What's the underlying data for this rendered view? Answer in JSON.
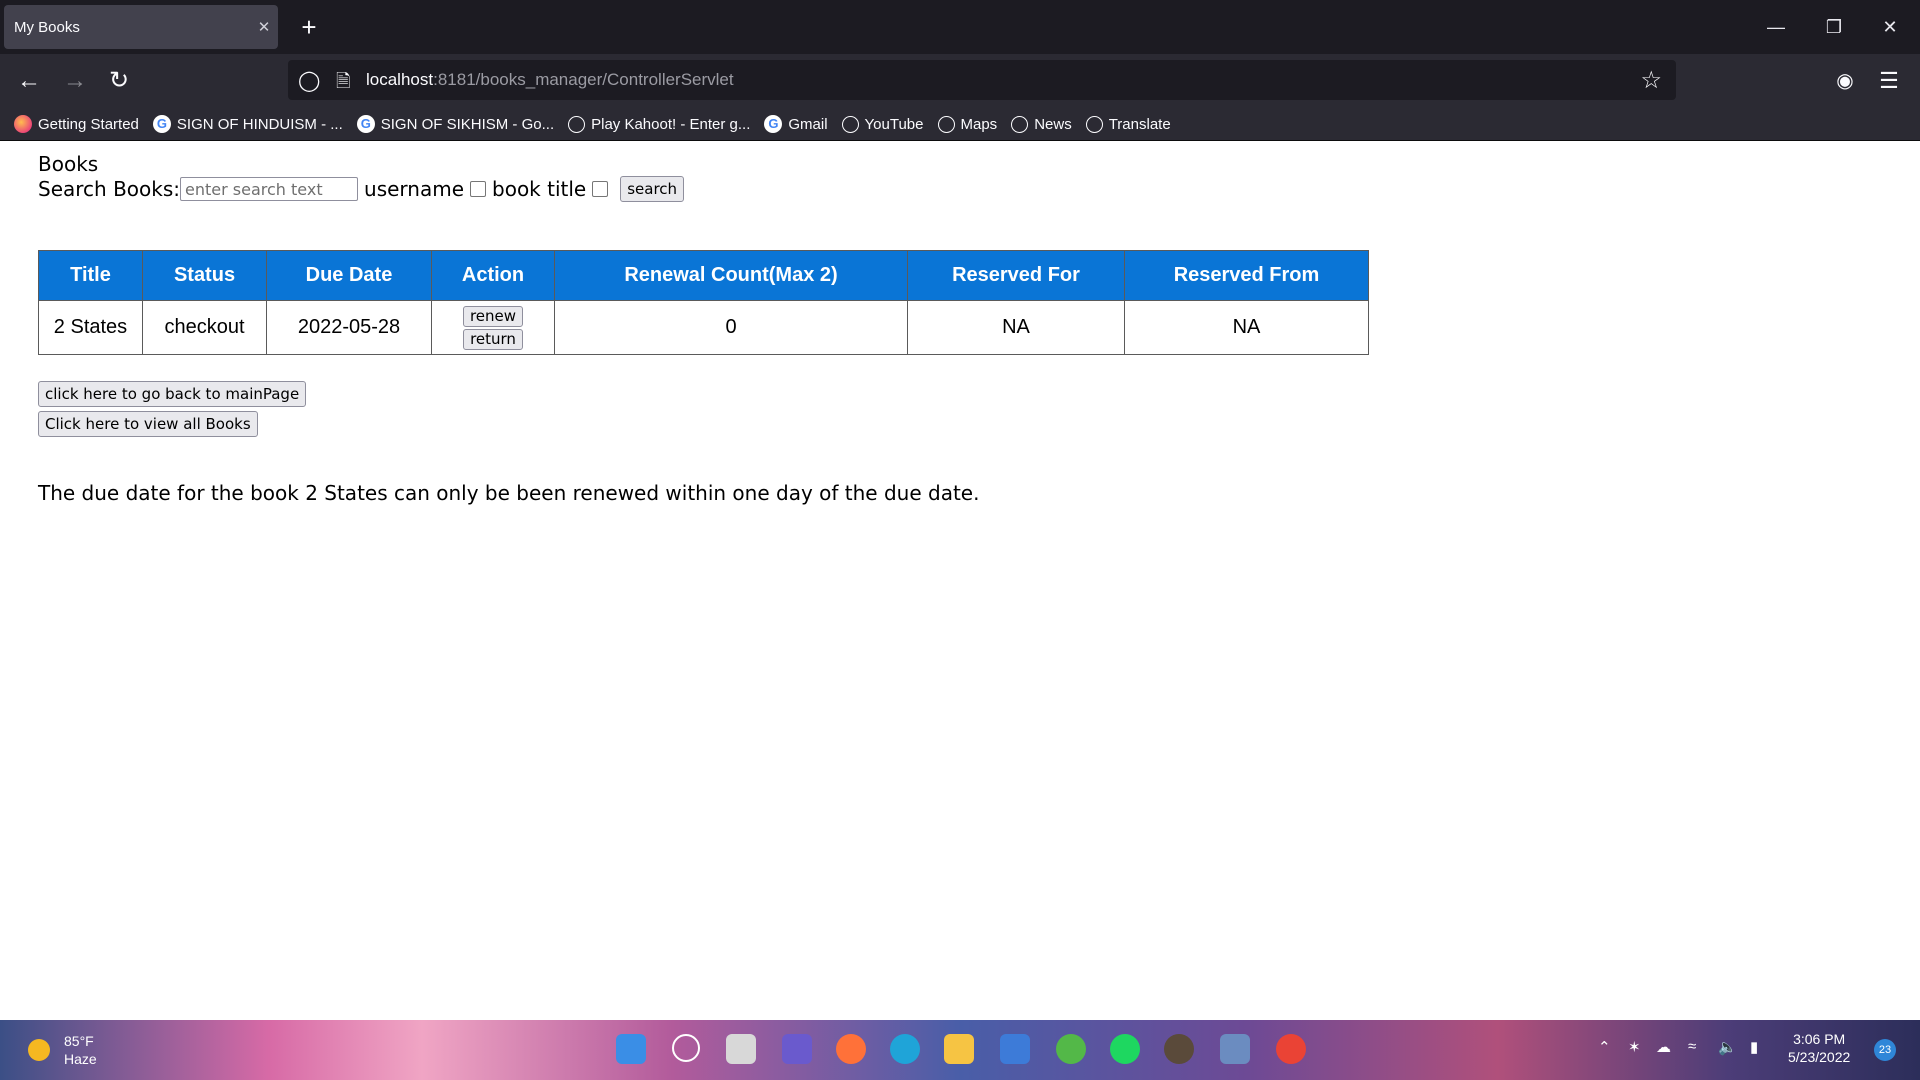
{
  "browser": {
    "tab_title": "My Books",
    "tab_close": "✕",
    "new_tab": "+",
    "url_host": "localhost",
    "url_rest": ":8181/books_manager/ControllerServlet",
    "bookmarks": [
      {
        "label": "Getting Started",
        "icon": "firefox-icon"
      },
      {
        "label": "SIGN OF HINDUISM - ...",
        "icon": "google-icon"
      },
      {
        "label": "SIGN OF SIKHISM - Go...",
        "icon": "google-icon"
      },
      {
        "label": "Play Kahoot! - Enter g...",
        "icon": "globe-icon"
      },
      {
        "label": "Gmail",
        "icon": "google-icon"
      },
      {
        "label": "YouTube",
        "icon": "globe-icon"
      },
      {
        "label": "Maps",
        "icon": "globe-icon"
      },
      {
        "label": "News",
        "icon": "globe-icon"
      },
      {
        "label": "Translate",
        "icon": "globe-icon"
      }
    ]
  },
  "page": {
    "heading": "Books",
    "search_label": "Search Books:",
    "search_placeholder": "enter search text",
    "username_label": "username",
    "book_title_label": "book title",
    "search_button": "search",
    "table": {
      "headers": [
        "Title",
        "Status",
        "Due Date",
        "Action",
        "Renewal Count(Max 2)",
        "Reserved For",
        "Reserved From"
      ],
      "rows": [
        {
          "title": "2 States",
          "status": "checkout",
          "due_date": "2022-05-28",
          "renew": "renew",
          "return": "return",
          "renewal_count": "0",
          "reserved_for": "NA",
          "reserved_from": "NA"
        }
      ]
    },
    "main_page_button": "click here to go back to mainPage",
    "view_all_button": "Click here to view all Books",
    "message": "The due date for the book 2 States can only be been renewed within one day of the due date."
  },
  "taskbar": {
    "temperature": "85°F",
    "condition": "Haze",
    "time": "3:06 PM",
    "date": "5/23/2022",
    "notifications": "23"
  },
  "colors": {
    "table_header": "#0a75d6",
    "chrome_dark": "#1c1b22",
    "chrome_mid": "#2b2a33"
  }
}
